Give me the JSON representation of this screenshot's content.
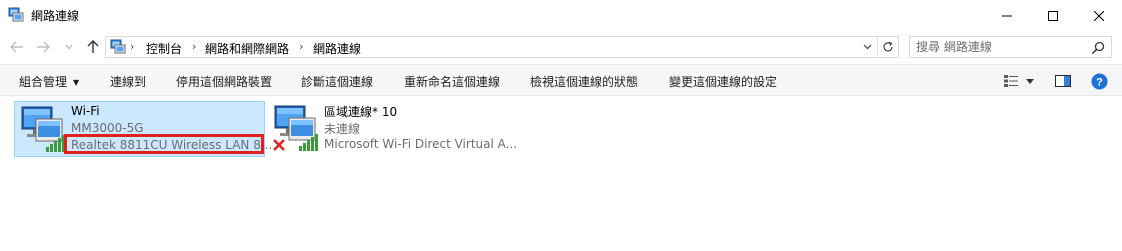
{
  "window": {
    "title": "網路連線",
    "controls": {
      "minimize": "—",
      "maximize": "☐",
      "close": "✕"
    }
  },
  "address_bar": {
    "breadcrumbs": [
      "控制台",
      "網路和網際網路",
      "網路連線"
    ],
    "separator": "›"
  },
  "search": {
    "placeholder": "搜尋 網路連線"
  },
  "commands": [
    {
      "label": "組合管理",
      "has_dropdown": true
    },
    {
      "label": "連線到"
    },
    {
      "label": "停用這個網路裝置"
    },
    {
      "label": "診斷這個連線"
    },
    {
      "label": "重新命名這個連線"
    },
    {
      "label": "檢視這個連線的狀態"
    },
    {
      "label": "變更這個連線的設定"
    }
  ],
  "connections": [
    {
      "name": "Wi-Fi",
      "status": "MM3000-5G",
      "device": "Realtek 8811CU Wireless LAN 8...",
      "selected": true,
      "device_highlighted": true,
      "signal_icon": "wifi-signal-icon"
    },
    {
      "name": "區域連線* 10",
      "status": "未連線",
      "device": "Microsoft Wi-Fi Direct Virtual A...",
      "selected": false,
      "disconnected": true,
      "signal_icon": "wifi-signal-icon"
    }
  ],
  "colors": {
    "selection_fill": "#cce8ff",
    "selection_border": "#99d1ff",
    "highlight_red": "#e0211d",
    "help_blue": "#1a73d9",
    "signal_green": "#3a9c3a"
  }
}
